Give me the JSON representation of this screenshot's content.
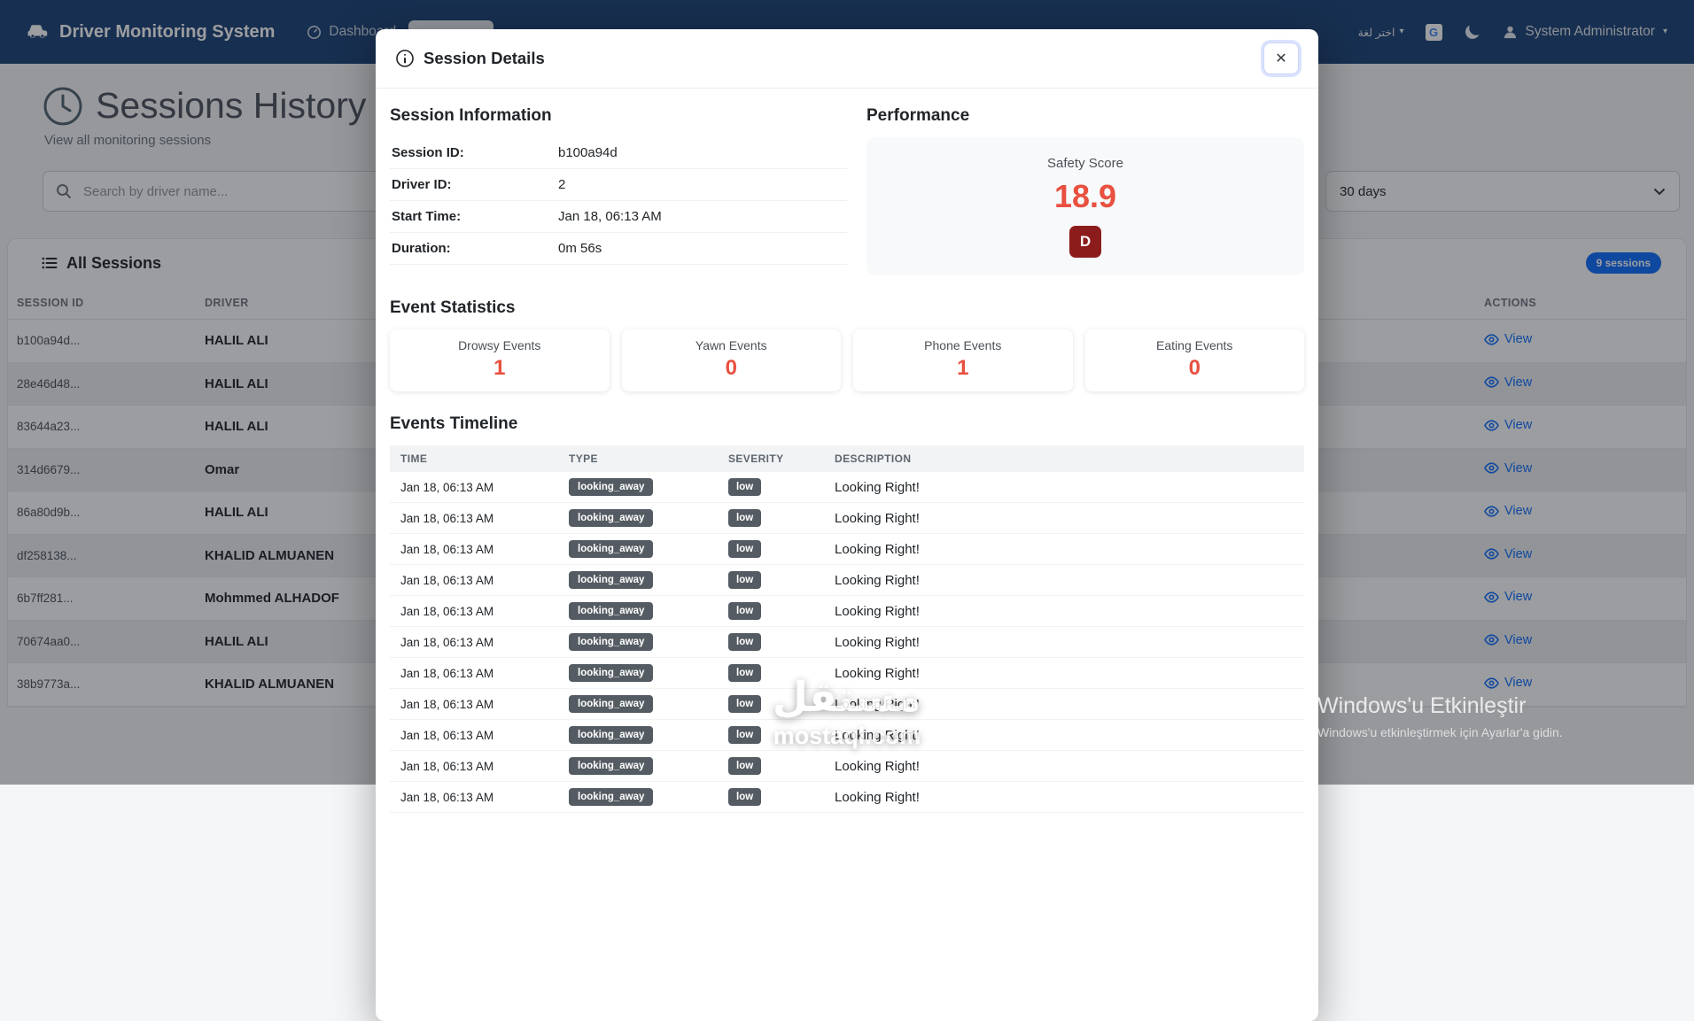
{
  "colors": {
    "navbar_bg": "#1a4275",
    "accent_blue": "#0d6efd",
    "score_red": "#e8503f",
    "grade_badge_bg": "#8c1c1c",
    "event_badge_bg": "#545b62",
    "page_bg": "#f4f6f8"
  },
  "icons": {
    "close": "✕",
    "caret_down": "▾"
  },
  "navbar": {
    "brand": "Driver Monitoring System",
    "dashboard_label": "Dashboard",
    "language_label": "اختر لغة",
    "user_label": "System Administrator"
  },
  "page": {
    "title": "Sessions History",
    "subtitle": "View all monitoring sessions",
    "search_placeholder": "Search by driver name...",
    "filter_value": "30 days",
    "sessions_header": "All Sessions",
    "sessions_badge": "9 sessions"
  },
  "sessions_table": {
    "columns": [
      "Session ID",
      "Driver",
      "Actions"
    ],
    "view_label": "View",
    "rows": [
      {
        "session_id": "b100a94d...",
        "driver": "HALIL ALI"
      },
      {
        "session_id": "28e46d48...",
        "driver": "HALIL ALI"
      },
      {
        "session_id": "83644a23...",
        "driver": "HALIL ALI"
      },
      {
        "session_id": "314d6679...",
        "driver": "Omar"
      },
      {
        "session_id": "86a80d9b...",
        "driver": "HALIL ALI"
      },
      {
        "session_id": "df258138...",
        "driver": "KHALID ALMUANEN"
      },
      {
        "session_id": "6b7ff281...",
        "driver": "Mohmmed ALHADOF"
      },
      {
        "session_id": "70674aa0...",
        "driver": "HALIL ALI"
      },
      {
        "session_id": "38b9773a...",
        "driver": "KHALID ALMUANEN"
      }
    ]
  },
  "modal": {
    "title": "Session Details",
    "session_information": {
      "heading": "Session Information",
      "fields": [
        {
          "label": "Session ID:",
          "value": "b100a94d"
        },
        {
          "label": "Driver ID:",
          "value": "2"
        },
        {
          "label": "Start Time:",
          "value": "Jan 18, 06:13 AM"
        },
        {
          "label": "Duration:",
          "value": "0m 56s"
        }
      ]
    },
    "performance": {
      "heading": "Performance",
      "score_label": "Safety Score",
      "score": "18.9",
      "grade": "D"
    },
    "event_statistics": {
      "heading": "Event Statistics",
      "stats": [
        {
          "label": "Drowsy Events",
          "value": "1"
        },
        {
          "label": "Yawn Events",
          "value": "0"
        },
        {
          "label": "Phone Events",
          "value": "1"
        },
        {
          "label": "Eating Events",
          "value": "0"
        }
      ]
    },
    "events_timeline": {
      "heading": "Events Timeline",
      "columns": [
        "Time",
        "Type",
        "Severity",
        "Description"
      ],
      "rows": [
        {
          "time": "Jan 18, 06:13 AM",
          "type": "looking_away",
          "severity": "low",
          "description": "Looking Right!"
        },
        {
          "time": "Jan 18, 06:13 AM",
          "type": "looking_away",
          "severity": "low",
          "description": "Looking Right!"
        },
        {
          "time": "Jan 18, 06:13 AM",
          "type": "looking_away",
          "severity": "low",
          "description": "Looking Right!"
        },
        {
          "time": "Jan 18, 06:13 AM",
          "type": "looking_away",
          "severity": "low",
          "description": "Looking Right!"
        },
        {
          "time": "Jan 18, 06:13 AM",
          "type": "looking_away",
          "severity": "low",
          "description": "Looking Right!"
        },
        {
          "time": "Jan 18, 06:13 AM",
          "type": "looking_away",
          "severity": "low",
          "description": "Looking Right!"
        },
        {
          "time": "Jan 18, 06:13 AM",
          "type": "looking_away",
          "severity": "low",
          "description": "Looking Right!"
        },
        {
          "time": "Jan 18, 06:13 AM",
          "type": "looking_away",
          "severity": "low",
          "description": "Looking Right!"
        },
        {
          "time": "Jan 18, 06:13 AM",
          "type": "looking_away",
          "severity": "low",
          "description": "Looking Right!"
        },
        {
          "time": "Jan 18, 06:13 AM",
          "type": "looking_away",
          "severity": "low",
          "description": "Looking Right!"
        },
        {
          "time": "Jan 18, 06:13 AM",
          "type": "looking_away",
          "severity": "low",
          "description": "Looking Right!"
        }
      ]
    }
  },
  "watermarks": {
    "mostaql_title": "مستقل",
    "mostaql_domain": "mostaql.com",
    "windows_title": "Windows'u Etkinleştir",
    "windows_subtitle": "Windows'u etkinleştirmek için Ayarlar'a gidin."
  }
}
